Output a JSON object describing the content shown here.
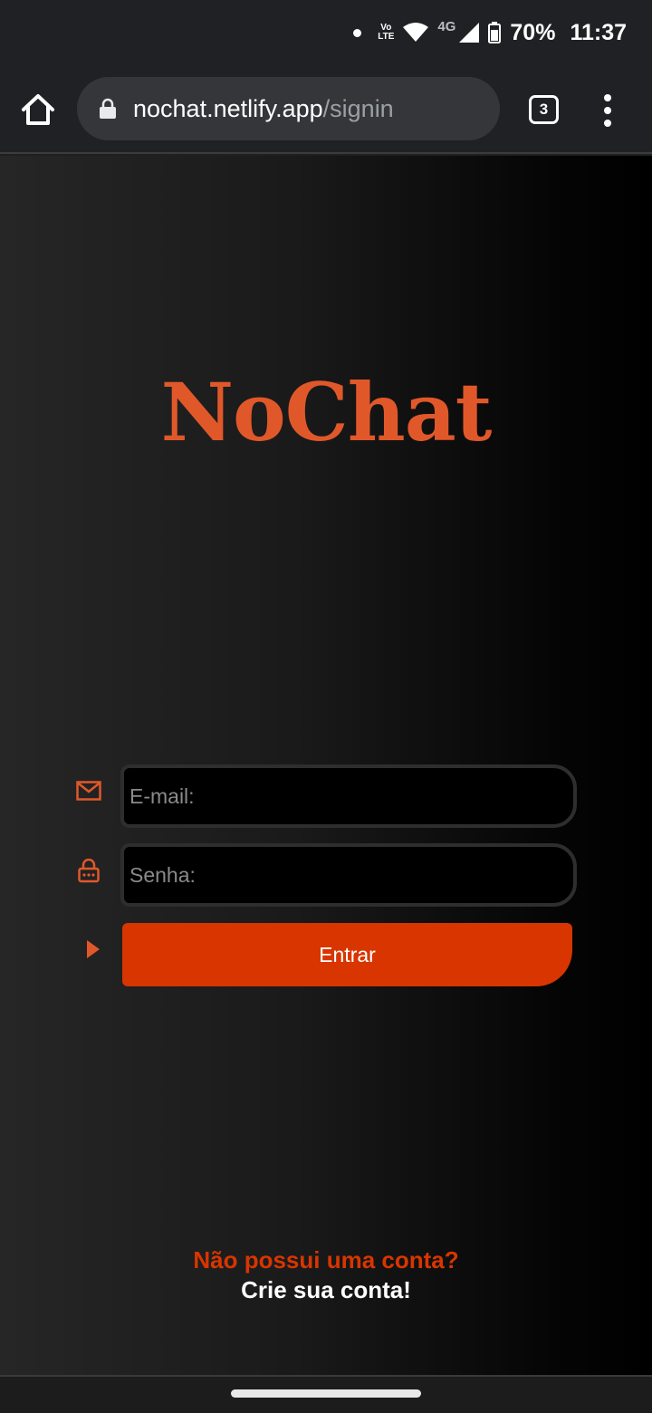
{
  "status_bar": {
    "network_label": "4G",
    "volte_top": "Vo",
    "volte_bottom": "LTE",
    "battery_percent": "70%",
    "time": "11:37"
  },
  "browser": {
    "url_host": "nochat.netlify.app",
    "url_path": "/signin",
    "tab_count": "3"
  },
  "page": {
    "logo": "NoChat",
    "email_placeholder": "E-mail:",
    "password_placeholder": "Senha:",
    "submit_label": "Entrar",
    "no_account_text": "Não possui uma conta?",
    "create_account_link": "Crie sua conta!"
  },
  "colors": {
    "accent": "#d83500",
    "logo": "#e0582a",
    "browser_bar": "#202124",
    "input_background": "#000000"
  },
  "icons": {
    "email": "envelope-icon",
    "password": "lock-icon",
    "submit": "play-arrow-icon"
  }
}
